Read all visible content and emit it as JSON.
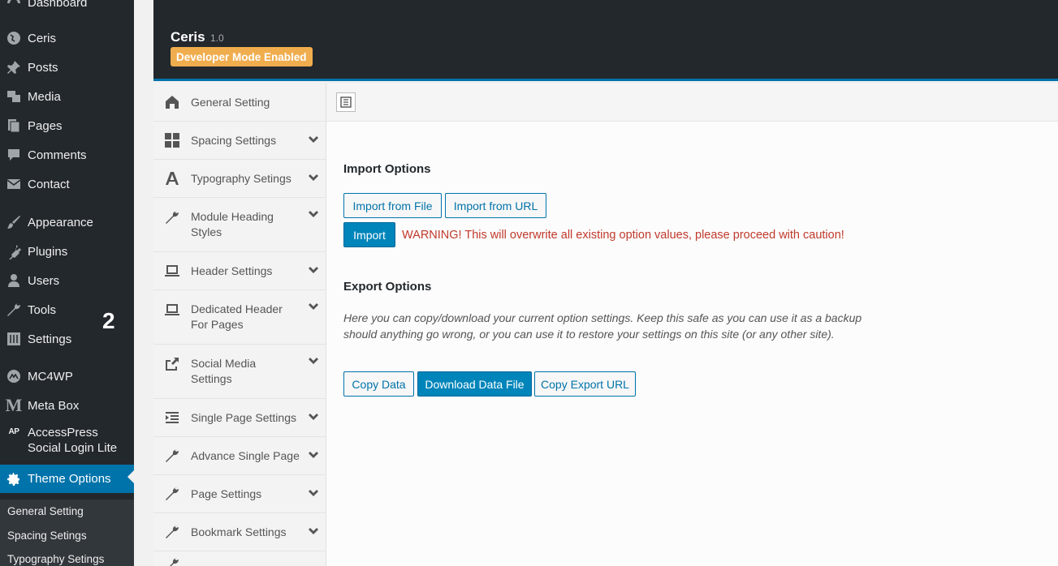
{
  "wp_menu": {
    "dashboard": "Dashboard",
    "items": [
      {
        "label": "Ceris",
        "icon": "globe-icon"
      },
      {
        "label": "Posts",
        "icon": "pin-icon"
      },
      {
        "label": "Media",
        "icon": "media-icon"
      },
      {
        "label": "Pages",
        "icon": "pages-icon"
      },
      {
        "label": "Comments",
        "icon": "comment-icon"
      },
      {
        "label": "Contact",
        "icon": "mail-icon"
      },
      {
        "label": "Appearance",
        "icon": "brush-icon"
      },
      {
        "label": "Plugins",
        "icon": "plug-icon"
      },
      {
        "label": "Users",
        "icon": "user-icon"
      },
      {
        "label": "Tools",
        "icon": "wrench-icon"
      },
      {
        "label": "Settings",
        "icon": "sliders-icon"
      },
      {
        "label": "MC4WP",
        "icon": "mc4wp-icon"
      },
      {
        "label": "Meta Box",
        "icon": "metabox-icon"
      },
      {
        "label": "AccessPress Social Login Lite",
        "icon": "ap-icon"
      },
      {
        "label": "Theme Options",
        "icon": "gear-icon"
      }
    ],
    "ap_badge": "AP",
    "meta_badge": "M",
    "submenu": [
      "General Setting",
      "Spacing Setings",
      "Typography Setings"
    ],
    "overlay_number": "2"
  },
  "header": {
    "theme_name": "Ceris",
    "version": "1.0",
    "badge": "Developer Mode Enabled"
  },
  "options_nav": [
    {
      "label": "General Setting",
      "icon": "home-icon",
      "has_chevron": false
    },
    {
      "label": "Spacing Settings",
      "icon": "grid-icon",
      "has_chevron": true
    },
    {
      "label": "Typography Setings",
      "icon": "font-icon",
      "has_chevron": true
    },
    {
      "label": "Module Heading Styles",
      "icon": "wrench-icon",
      "has_chevron": true
    },
    {
      "label": "Header Settings",
      "icon": "laptop-icon",
      "has_chevron": true
    },
    {
      "label": "Dedicated Header For Pages",
      "icon": "laptop-icon",
      "has_chevron": true
    },
    {
      "label": "Social Media Settings",
      "icon": "share-icon",
      "has_chevron": true
    },
    {
      "label": "Single Page Settings",
      "icon": "indent-icon",
      "has_chevron": true
    },
    {
      "label": "Advance Single Page",
      "icon": "wrench-icon",
      "has_chevron": true
    },
    {
      "label": "Page Settings",
      "icon": "wrench-icon",
      "has_chevron": true
    },
    {
      "label": "Bookmark Settings",
      "icon": "wrench-icon",
      "has_chevron": true
    }
  ],
  "main": {
    "import_title": "Import Options",
    "import_from_file": "Import from File",
    "import_from_url": "Import from URL",
    "import_button": "Import",
    "warning": "WARNING! This will overwrite all existing option values, please proceed with caution!",
    "export_title": "Export Options",
    "export_desc": "Here you can copy/download your current option settings. Keep this safe as you can use it as a backup should anything go wrong, or you can use it to restore your settings on this site (or any other site).",
    "copy_data": "Copy Data",
    "download_data_file": "Download Data File",
    "copy_export_url": "Copy Export URL"
  },
  "colors": {
    "wp_sidebar": "#23282d",
    "accent": "#0073aa",
    "badge": "#f0ad4e",
    "warning": "#c0392b"
  }
}
